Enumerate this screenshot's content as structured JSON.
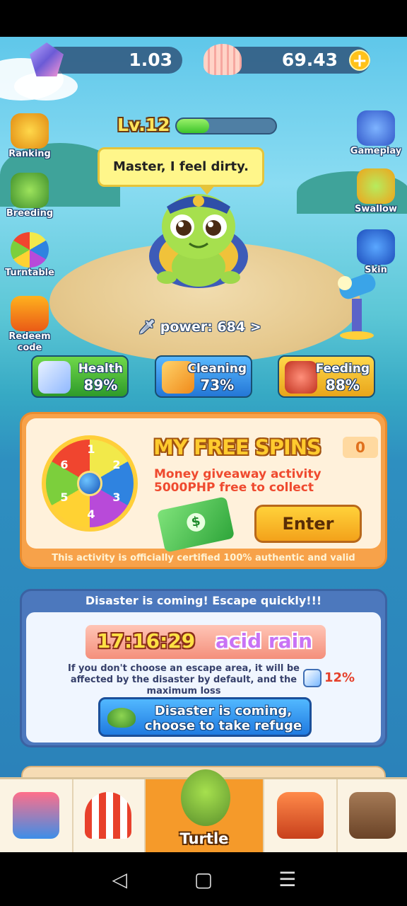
{
  "currency": {
    "gems": "1.03",
    "shells": "69.43"
  },
  "level": {
    "label": "Lv.12",
    "progress": 0.33
  },
  "speech": "Master, I feel dirty.",
  "power": "power: 684 >",
  "side_left": [
    {
      "label": "Ranking",
      "icon": "trophy-icon"
    },
    {
      "label": "Breeding",
      "icon": "baby-turtle-icon"
    },
    {
      "label": "Turntable",
      "icon": "wheel-icon"
    },
    {
      "label": "Redeem code",
      "icon": "code-icon"
    }
  ],
  "side_right": [
    {
      "label": "Gameplay",
      "icon": "gamepad-icon"
    },
    {
      "label": "Swallow",
      "icon": "swallow-icon"
    },
    {
      "label": "Skin",
      "icon": "shirt-icon"
    }
  ],
  "stats": [
    {
      "label": "Health",
      "value": "89%",
      "icon": "first-aid-icon"
    },
    {
      "label": "Cleaning",
      "value": "73%",
      "icon": "brush-icon"
    },
    {
      "label": "Feeding",
      "value": "88%",
      "icon": "meat-icon"
    }
  ],
  "spins": {
    "title": "MY FREE SPINS",
    "count": "0",
    "line1": "Money giveaway activity",
    "line2": "5000PHP free to collect",
    "enter": "Enter",
    "certified": "This activity is officially certified 100% authentic and valid",
    "wheel_numbers": [
      "1",
      "2",
      "3",
      "4",
      "5",
      "6"
    ]
  },
  "disaster": {
    "header": "Disaster is coming! Escape quickly!!!",
    "timer": "17:16:29",
    "name": "acid rain",
    "desc": "If you don't choose an escape area, it will be affected by the disaster by default, and the maximum loss",
    "loss": "12%",
    "button_line1": "Disaster is coming,",
    "button_line2": "choose to take refuge"
  },
  "tabs": [
    {
      "label": "",
      "icon": "shop-icon"
    },
    {
      "label": "",
      "icon": "circus-tent-icon"
    },
    {
      "label": "Turtle",
      "icon": "turtle-icon"
    },
    {
      "label": "",
      "icon": "backpack-icon"
    },
    {
      "label": "",
      "icon": "contacts-book-icon"
    }
  ],
  "colors": {
    "accent_orange": "#f59a2a",
    "progress_green": "#3cc42a",
    "loss_red": "#e5402b"
  }
}
